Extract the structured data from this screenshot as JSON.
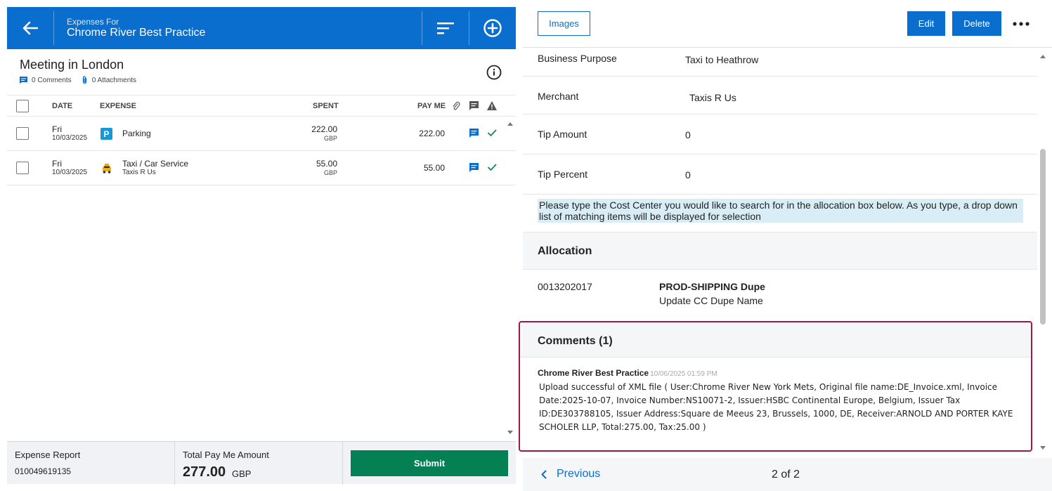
{
  "header": {
    "subtitle": "Expenses For",
    "title": "Chrome River Best Practice"
  },
  "report": {
    "title": "Meeting in London",
    "comments": "0 Comments",
    "attachments": "0 Attachments"
  },
  "table": {
    "columns": {
      "date": "DATE",
      "expense": "EXPENSE",
      "spent": "SPENT",
      "payme": "PAY ME"
    },
    "rows": [
      {
        "day": "Fri",
        "date": "10/03/2025",
        "expense": "Parking",
        "sub": "",
        "icon": "parking-icon",
        "spent": "222.00",
        "currency": "GBP",
        "payme": "222.00"
      },
      {
        "day": "Fri",
        "date": "10/03/2025",
        "expense": "Taxi / Car Service",
        "sub": "Taxis R Us",
        "icon": "taxi-icon",
        "spent": "55.00",
        "currency": "GBP",
        "payme": "55.00"
      }
    ]
  },
  "footer": {
    "report_label": "Expense Report",
    "report_number": "010049619135",
    "total_label": "Total Pay Me Amount",
    "total_amount": "277.00",
    "total_currency": "GBP",
    "submit_label": "Submit"
  },
  "detail_toolbar": {
    "images_label": "Images",
    "edit_label": "Edit",
    "delete_label": "Delete"
  },
  "fields": [
    {
      "label": "Business Purpose",
      "value": "Taxi to Heathrow"
    },
    {
      "label": "Merchant",
      "value": "Taxis R Us"
    },
    {
      "label": "Tip Amount",
      "value": "0"
    },
    {
      "label": "Tip Percent",
      "value": "0"
    }
  ],
  "notice": "Please type the Cost Center you would like to search for in the allocation box below. As you type, a drop down list of matching items will be displayed for selection",
  "allocation": {
    "title": "Allocation",
    "code": "0013202017",
    "name": "PROD-SHIPPING Dupe",
    "description": "Update CC Dupe Name"
  },
  "comments": {
    "title": "Comments  (1)",
    "author": "Chrome River Best Practice",
    "timestamp": "10/06/2025 01:59 PM",
    "text": "Upload successful of XML file ( User:Chrome River New York Mets, Original file name:DE_Invoice.xml, Invoice Date:2025-10-07, Invoice Number:NS10071-2, Issuer:HSBC Continental Europe, Belgium, Issuer Tax ID:DE303788105, Issuer Address:Square de Meeus 23,  Brussels,  1000,  DE, Receiver:ARNOLD AND PORTER KAYE SCHOLER LLP, Total:275.00, Tax:25.00 )"
  },
  "pager": {
    "previous_label": "Previous",
    "count": "2 of 2"
  },
  "colors": {
    "brand_blue": "#0a6ece",
    "submit_green": "#058055",
    "highlight_border": "#a0174a",
    "notice_bg": "#d9edf7"
  }
}
